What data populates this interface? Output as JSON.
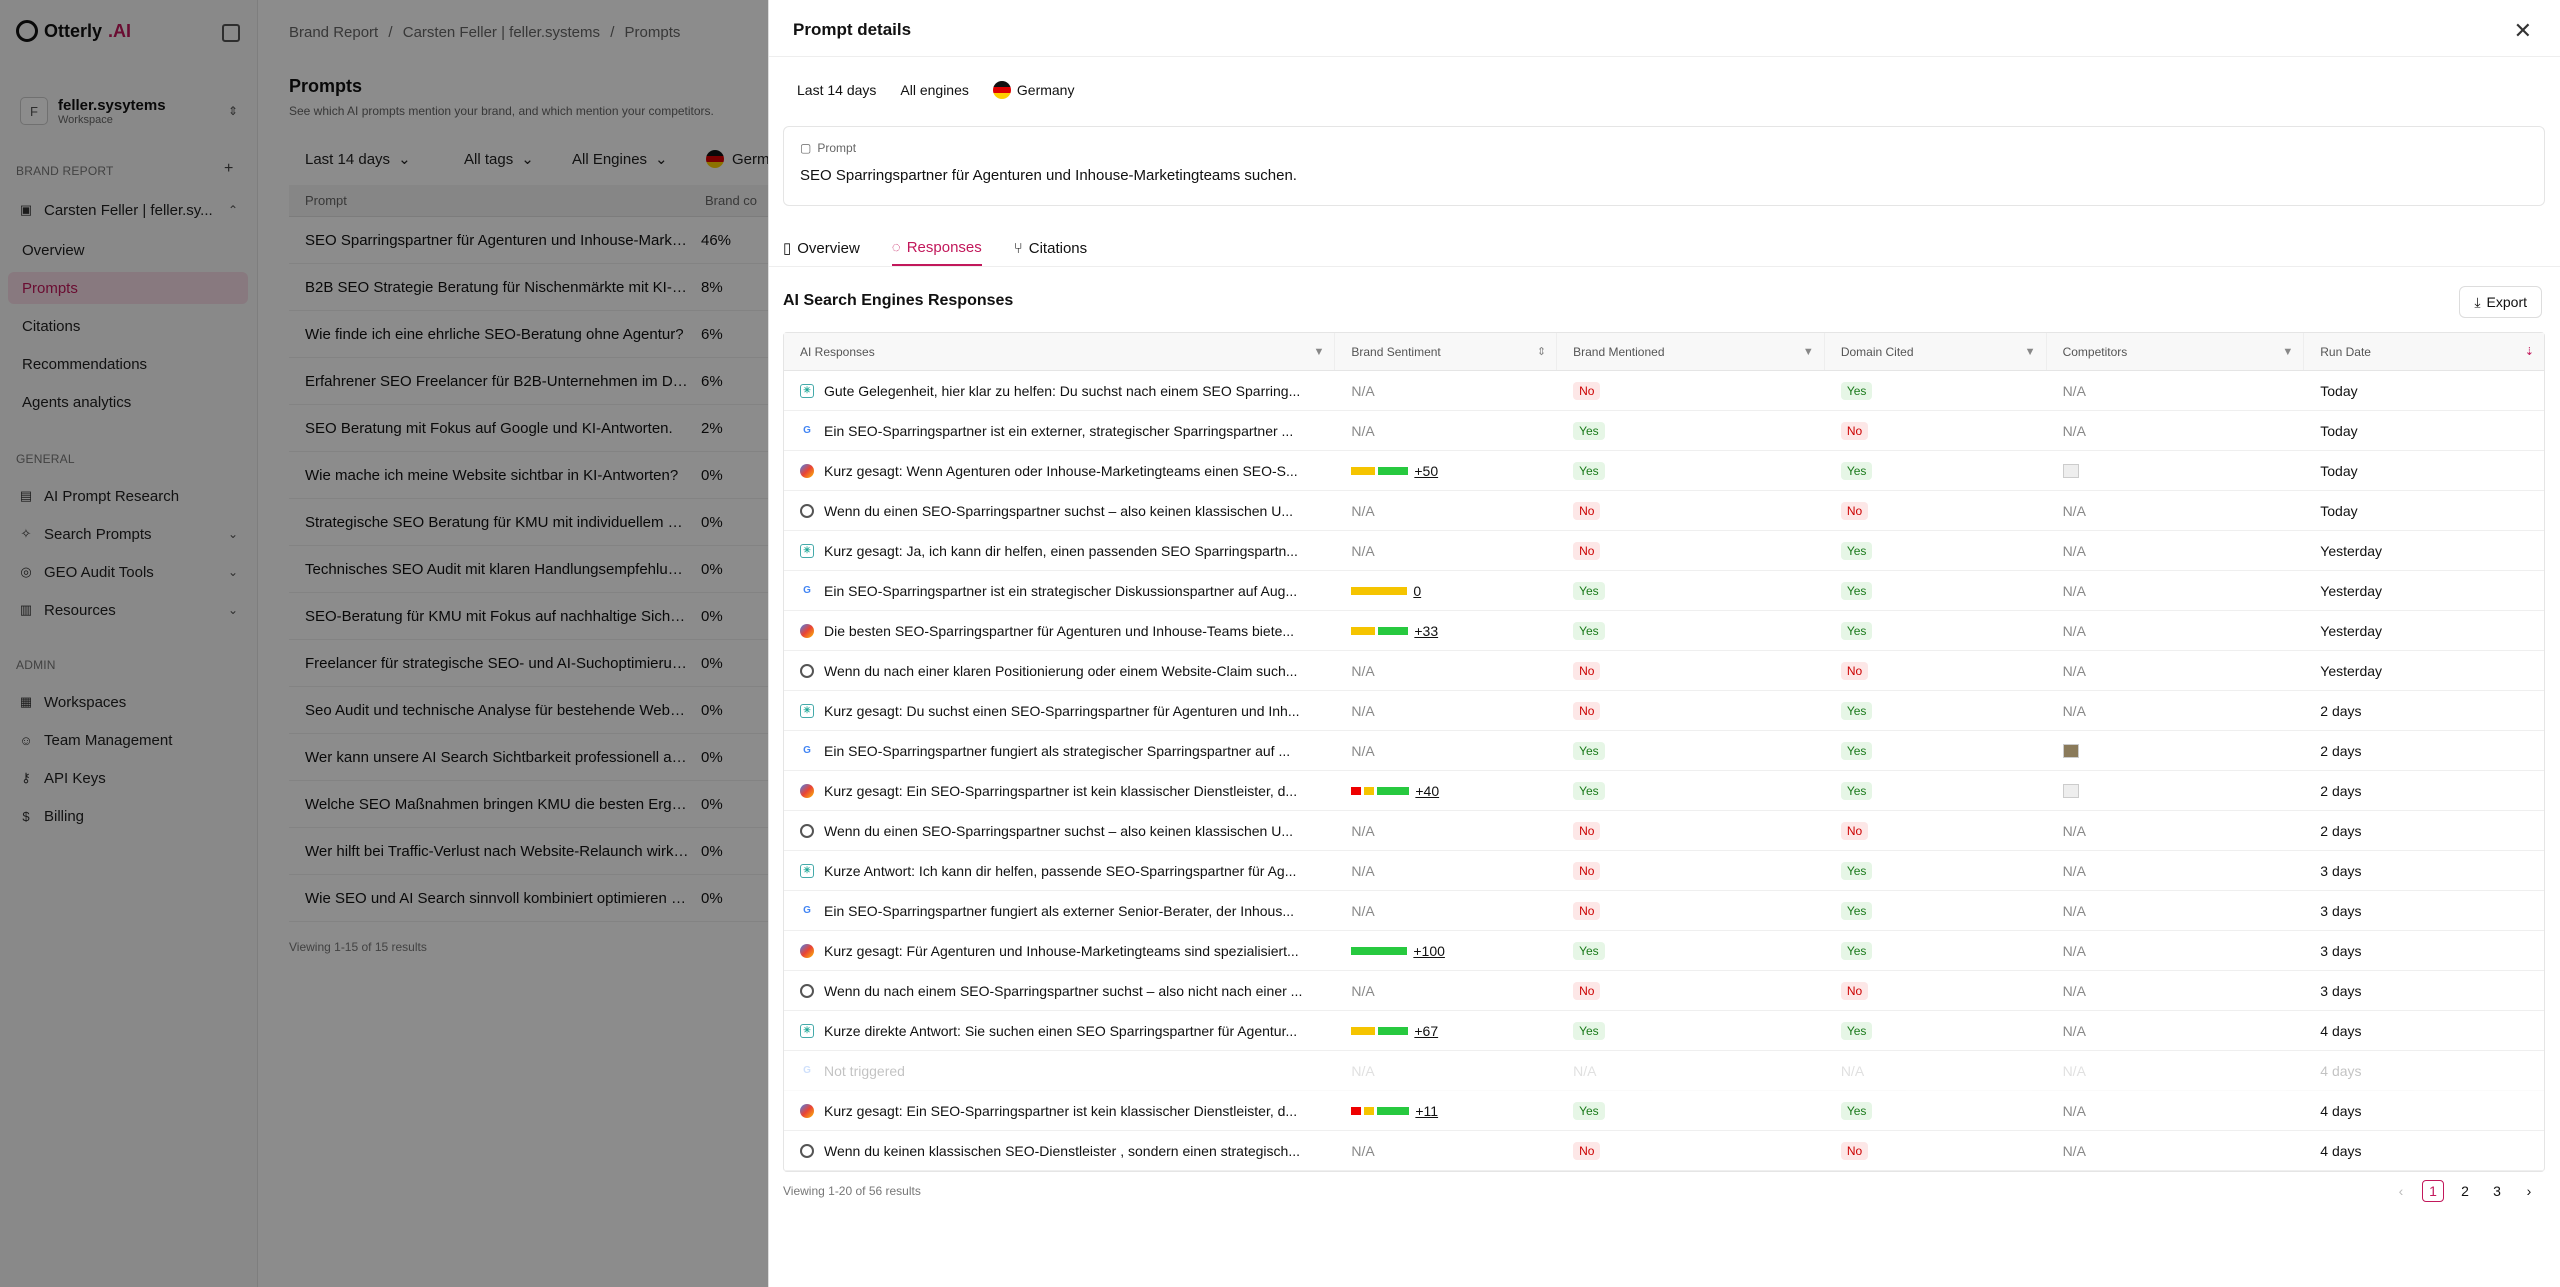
{
  "app": {
    "logo_prefix": "Otterly",
    "logo_suffix": ".AI"
  },
  "workspace": {
    "name": "feller.sysytems",
    "sub": "Workspace",
    "initial": "F"
  },
  "sidebar": {
    "brand_report_label": "BRAND REPORT",
    "brand": "Carsten Feller | feller.sy...",
    "brand_items": [
      "Overview",
      "Prompts",
      "Citations",
      "Recommendations",
      "Agents analytics"
    ],
    "general_label": "GENERAL",
    "general_items": [
      "AI Prompt Research",
      "Search Prompts",
      "GEO Audit Tools",
      "Resources"
    ],
    "admin_label": "ADMIN",
    "admin_items": [
      "Workspaces",
      "Team Management",
      "API Keys",
      "Billing"
    ]
  },
  "breadcrumb": {
    "a": "Brand Report",
    "b": "Carsten Feller | feller.systems",
    "c": "Prompts",
    "sep": "/"
  },
  "page": {
    "title": "Prompts",
    "subtitle": "See which AI prompts mention your brand, and which mention your competitors."
  },
  "filters": {
    "date": "Last 14 days",
    "tags": "All tags",
    "engines": "All Engines",
    "country": "Germa"
  },
  "left_table": {
    "headers": [
      "Prompt",
      "Brand co"
    ],
    "rows": [
      [
        "SEO Sparringspartner für Agenturen und Inhouse-Marke...",
        "46%"
      ],
      [
        "B2B SEO Strategie Beratung für Nischenmärkte mit KI-Fo...",
        "8%"
      ],
      [
        "Wie finde ich eine ehrliche SEO-Beratung ohne Agentur?",
        "6%"
      ],
      [
        "Erfahrener SEO Freelancer für B2B-Unternehmen im DA...",
        "6%"
      ],
      [
        "SEO Beratung mit Fokus auf Google und KI-Antworten.",
        "2%"
      ],
      [
        "Wie mache ich meine Website sichtbar in KI-Antworten?",
        "0%"
      ],
      [
        "Strategische SEO Beratung für KMU mit individuellem Re...",
        "0%"
      ],
      [
        "Technisches SEO Audit mit klaren Handlungsempfehlung...",
        "0%"
      ],
      [
        "SEO-Beratung für KMU mit Fokus auf nachhaltige Sichtb...",
        "0%"
      ],
      [
        "Freelancer für strategische SEO- und AI-Suchoptimierun...",
        "0%"
      ],
      [
        "Seo Audit und technische Analyse für bestehende Websi...",
        "0%"
      ],
      [
        "Wer kann unsere AI Search Sichtbarkeit professionell an...",
        "0%"
      ],
      [
        "Welche SEO Maßnahmen bringen KMU die besten Ergeb...",
        "0%"
      ],
      [
        "Wer hilft bei Traffic-Verlust nach Website-Relaunch wirkli...",
        "0%"
      ],
      [
        "Wie SEO und AI Search sinnvoll kombiniert optimieren la...",
        "0%"
      ]
    ],
    "footer": "Viewing 1-15 of 15 results"
  },
  "panel": {
    "title": "Prompt details",
    "chips": [
      "Last 14 days",
      "All engines",
      "Germany"
    ],
    "prompt_label": "Prompt",
    "prompt_text": "SEO Sparringspartner für Agenturen und Inhouse-Marketingteams suchen.",
    "tabs": [
      "Overview",
      "Responses",
      "Citations"
    ],
    "section_title": "AI Search Engines Responses",
    "export_label": "Export",
    "headers": [
      "AI Responses",
      "Brand Sentiment",
      "Brand Mentioned",
      "Domain Cited",
      "Competitors",
      "Run Date"
    ],
    "rows": [
      {
        "engine": "perplexity",
        "text": "Gute Gelegenheit, hier klar zu helfen: Du suchst nach einem SEO Sparring...",
        "sent": "N/A",
        "mentioned": "No",
        "cited": "Yes",
        "comp": "N/A",
        "date": "Today"
      },
      {
        "engine": "google",
        "text": "Ein SEO-Sparringspartner ist ein externer, strategischer Sparringspartner ...",
        "sent": "N/A",
        "mentioned": "Yes",
        "cited": "No",
        "comp": "N/A",
        "date": "Today"
      },
      {
        "engine": "gemini",
        "text": "Kurz gesagt: Wenn Agenturen oder Inhouse-Marketingteams einen SEO-S...",
        "sent": "+50",
        "bars": [
          "#f5c400",
          "#27c93f"
        ],
        "mentioned": "Yes",
        "cited": "Yes",
        "comp": "icon",
        "date": "Today"
      },
      {
        "engine": "chatgpt",
        "text": "Wenn du einen SEO-Sparringspartner suchst – also keinen klassischen U...",
        "sent": "N/A",
        "mentioned": "No",
        "cited": "No",
        "comp": "N/A",
        "date": "Today"
      },
      {
        "engine": "perplexity",
        "text": "Kurz gesagt: Ja, ich kann dir helfen, einen passenden SEO Sparringspartn...",
        "sent": "N/A",
        "mentioned": "No",
        "cited": "Yes",
        "comp": "N/A",
        "date": "Yesterday"
      },
      {
        "engine": "google",
        "text": "Ein SEO-Sparringspartner ist ein strategischer Diskussionspartner auf Aug...",
        "sent": "0",
        "bars": [
          "#f5c400"
        ],
        "mentioned": "Yes",
        "cited": "Yes",
        "comp": "N/A",
        "date": "Yesterday"
      },
      {
        "engine": "gemini",
        "text": "Die besten SEO-Sparringspartner für Agenturen und Inhouse-Teams biete...",
        "sent": "+33",
        "bars": [
          "#f5c400",
          "#27c93f"
        ],
        "mentioned": "Yes",
        "cited": "Yes",
        "comp": "N/A",
        "date": "Yesterday"
      },
      {
        "engine": "chatgpt",
        "text": "Wenn du nach einer klaren Positionierung oder einem Website-Claim such...",
        "sent": "N/A",
        "mentioned": "No",
        "cited": "No",
        "comp": "N/A",
        "date": "Yesterday"
      },
      {
        "engine": "perplexity",
        "text": "Kurz gesagt: Du suchst einen SEO-Sparringspartner für Agenturen und Inh...",
        "sent": "N/A",
        "mentioned": "No",
        "cited": "Yes",
        "comp": "N/A",
        "date": "2 days"
      },
      {
        "engine": "google",
        "text": "Ein SEO-Sparringspartner fungiert als strategischer Sparringspartner auf ...",
        "sent": "N/A",
        "mentioned": "Yes",
        "cited": "Yes",
        "comp": "img",
        "date": "2 days"
      },
      {
        "engine": "gemini",
        "text": "Kurz gesagt: Ein SEO-Sparringspartner ist kein klassischer Dienstleister, d...",
        "sent": "+40",
        "bars": [
          "#e00",
          "#f5c400",
          "#27c93f"
        ],
        "mentioned": "Yes",
        "cited": "Yes",
        "comp": "icon",
        "date": "2 days"
      },
      {
        "engine": "chatgpt",
        "text": "Wenn du einen SEO-Sparringspartner suchst – also keinen klassischen U...",
        "sent": "N/A",
        "mentioned": "No",
        "cited": "No",
        "comp": "N/A",
        "date": "2 days"
      },
      {
        "engine": "perplexity",
        "text": "Kurze Antwort: Ich kann dir helfen, passende SEO-Sparringspartner für Ag...",
        "sent": "N/A",
        "mentioned": "No",
        "cited": "Yes",
        "comp": "N/A",
        "date": "3 days"
      },
      {
        "engine": "google",
        "text": "Ein SEO-Sparringspartner fungiert als externer Senior-Berater, der Inhous...",
        "sent": "N/A",
        "mentioned": "No",
        "cited": "Yes",
        "comp": "N/A",
        "date": "3 days"
      },
      {
        "engine": "gemini",
        "text": "Kurz gesagt: Für Agenturen und Inhouse-Marketingteams sind spezialisiert...",
        "sent": "+100",
        "bars": [
          "#27c93f"
        ],
        "mentioned": "Yes",
        "cited": "Yes",
        "comp": "N/A",
        "date": "3 days"
      },
      {
        "engine": "chatgpt",
        "text": "Wenn du nach einem SEO-Sparringspartner suchst – also nicht nach einer ...",
        "sent": "N/A",
        "mentioned": "No",
        "cited": "No",
        "comp": "N/A",
        "date": "3 days"
      },
      {
        "engine": "perplexity",
        "text": "Kurze direkte Antwort: Sie suchen einen SEO Sparringspartner für Agentur...",
        "sent": "+67",
        "bars": [
          "#f5c400",
          "#27c93f"
        ],
        "mentioned": "Yes",
        "cited": "Yes",
        "comp": "N/A",
        "date": "4 days"
      },
      {
        "engine": "google",
        "text": "Not triggered",
        "sent": "N/A",
        "mentioned": "N/A",
        "cited": "N/A",
        "comp": "N/A",
        "date": "4 days",
        "dim": true
      },
      {
        "engine": "gemini",
        "text": "Kurz gesagt: Ein SEO-Sparringspartner ist kein klassischer Dienstleister, d...",
        "sent": "+11",
        "bars": [
          "#e00",
          "#f5c400",
          "#27c93f"
        ],
        "mentioned": "Yes",
        "cited": "Yes",
        "comp": "N/A",
        "date": "4 days"
      },
      {
        "engine": "chatgpt",
        "text": "Wenn du keinen klassischen SEO-Dienstleister , sondern einen strategisch...",
        "sent": "N/A",
        "mentioned": "No",
        "cited": "No",
        "comp": "N/A",
        "date": "4 days"
      }
    ],
    "footer": "Viewing 1-20 of 56 results",
    "pages": [
      "1",
      "2",
      "3"
    ],
    "prev_icon": "‹",
    "next_icon": "›"
  },
  "colors": {
    "accent": "#c2185b"
  }
}
